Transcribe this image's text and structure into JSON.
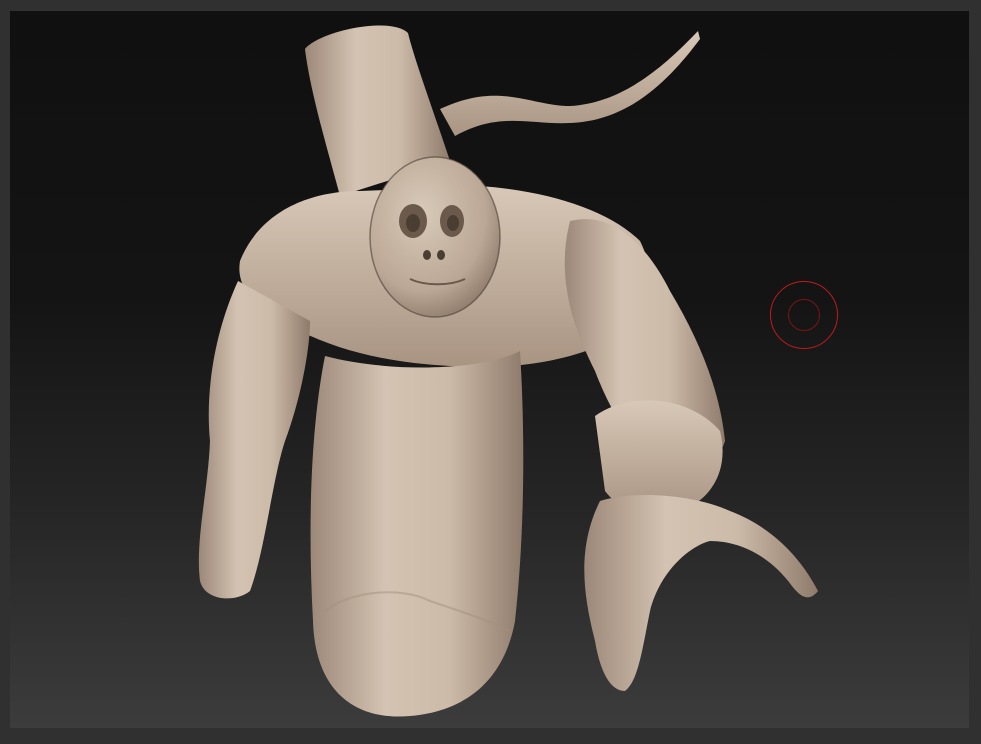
{
  "viewport": {
    "background_top": "#101010",
    "background_bottom": "#3c3c3c",
    "frame_color": "#303030"
  },
  "sculpt": {
    "material_color": "#c9b7a5",
    "shadow_color": "#8e7c6c",
    "highlight_color": "#e8dccf"
  },
  "brush_cursor": {
    "icon": "brush-circle-icon",
    "color": "#c21a1a"
  }
}
